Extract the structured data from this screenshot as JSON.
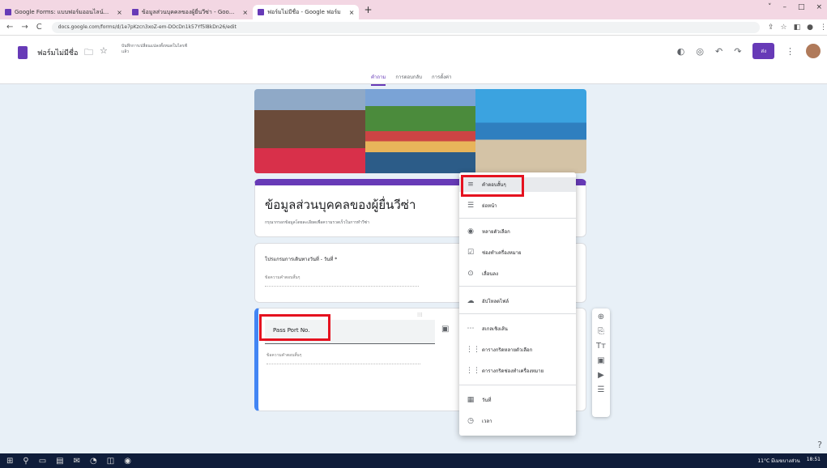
{
  "browser": {
    "tabs": [
      {
        "label": "Google Forms: แบบฟอร์มออนไลน์...",
        "active": false
      },
      {
        "label": "ข้อมูลส่วนบุคคลของผู้ยื่นวีซ่า - Goo...",
        "active": false
      },
      {
        "label": "ฟอร์มไม่มีชื่อ - Google ฟอร์ม",
        "active": true
      }
    ],
    "new_tab": "+",
    "url": "docs.google.com/forms/d/1e7pKzcn3xoZ-em-DOcDn1k57Yf5l8kDn26/edit",
    "nav": {
      "back": "←",
      "forward": "→",
      "reload": "C"
    },
    "window_controls": [
      "˅",
      "–",
      "□",
      "×"
    ]
  },
  "forms_header": {
    "title": "ฟอร์มไม่มีชื่อ",
    "save_status": "บันทึกการเปลี่ยนแปลงทั้งหมดในไดรฟ์แล้ว",
    "send_label": "ส่ง",
    "tabs": [
      "คำถาม",
      "การตอบกลับ",
      "การตั้งค่า"
    ]
  },
  "form": {
    "title": "ข้อมูลส่วนบุคคลของผู้ยื่นวีซ่า",
    "description": "กรุณากรอกข้อมูลโดยละเอียดเพื่อความรวดเร็วในการทำวีซ่า",
    "q1": {
      "label": "โปรแกรมการเดินทางวันที่ - วันที่ *",
      "answer_placeholder": "ข้อความคำตอบสั้นๆ"
    },
    "q2": {
      "label": "Pass Port No.",
      "answer_placeholder": "ข้อความคำตอบสั้นๆ"
    }
  },
  "type_menu": {
    "items": [
      {
        "icon": "≡",
        "label": "คำตอบสั้นๆ",
        "selected": true
      },
      {
        "icon": "☰",
        "label": "ย่อหน้า",
        "selected": false
      },
      {
        "icon": "◉",
        "label": "หลายตัวเลือก",
        "selected": false
      },
      {
        "icon": "☑",
        "label": "ช่องทำเครื่องหมาย",
        "selected": false
      },
      {
        "icon": "⊙",
        "label": "เลื่อนลง",
        "selected": false
      },
      {
        "icon": "☁",
        "label": "อัปโหลดไฟล์",
        "selected": false
      },
      {
        "icon": "⋯",
        "label": "สเกลเชิงเส้น",
        "selected": false
      },
      {
        "icon": "⋮⋮",
        "label": "ตารางกริดหลายตัวเลือก",
        "selected": false
      },
      {
        "icon": "⋮⋮",
        "label": "ตารางกริดช่องทำเครื่องหมาย",
        "selected": false
      },
      {
        "icon": "▦",
        "label": "วันที่",
        "selected": false
      },
      {
        "icon": "◷",
        "label": "เวลา",
        "selected": false
      }
    ]
  },
  "side_tools": [
    "⊕",
    "⎘",
    "Tт",
    "▣",
    "▶",
    "☰"
  ],
  "taskbar": {
    "weather": "11°C มีเมฆบางส่วน",
    "time": "18:51"
  },
  "colors": {
    "primary": "#673ab7",
    "highlight_box": "#e5121f",
    "accent_blue": "#4285f4"
  }
}
